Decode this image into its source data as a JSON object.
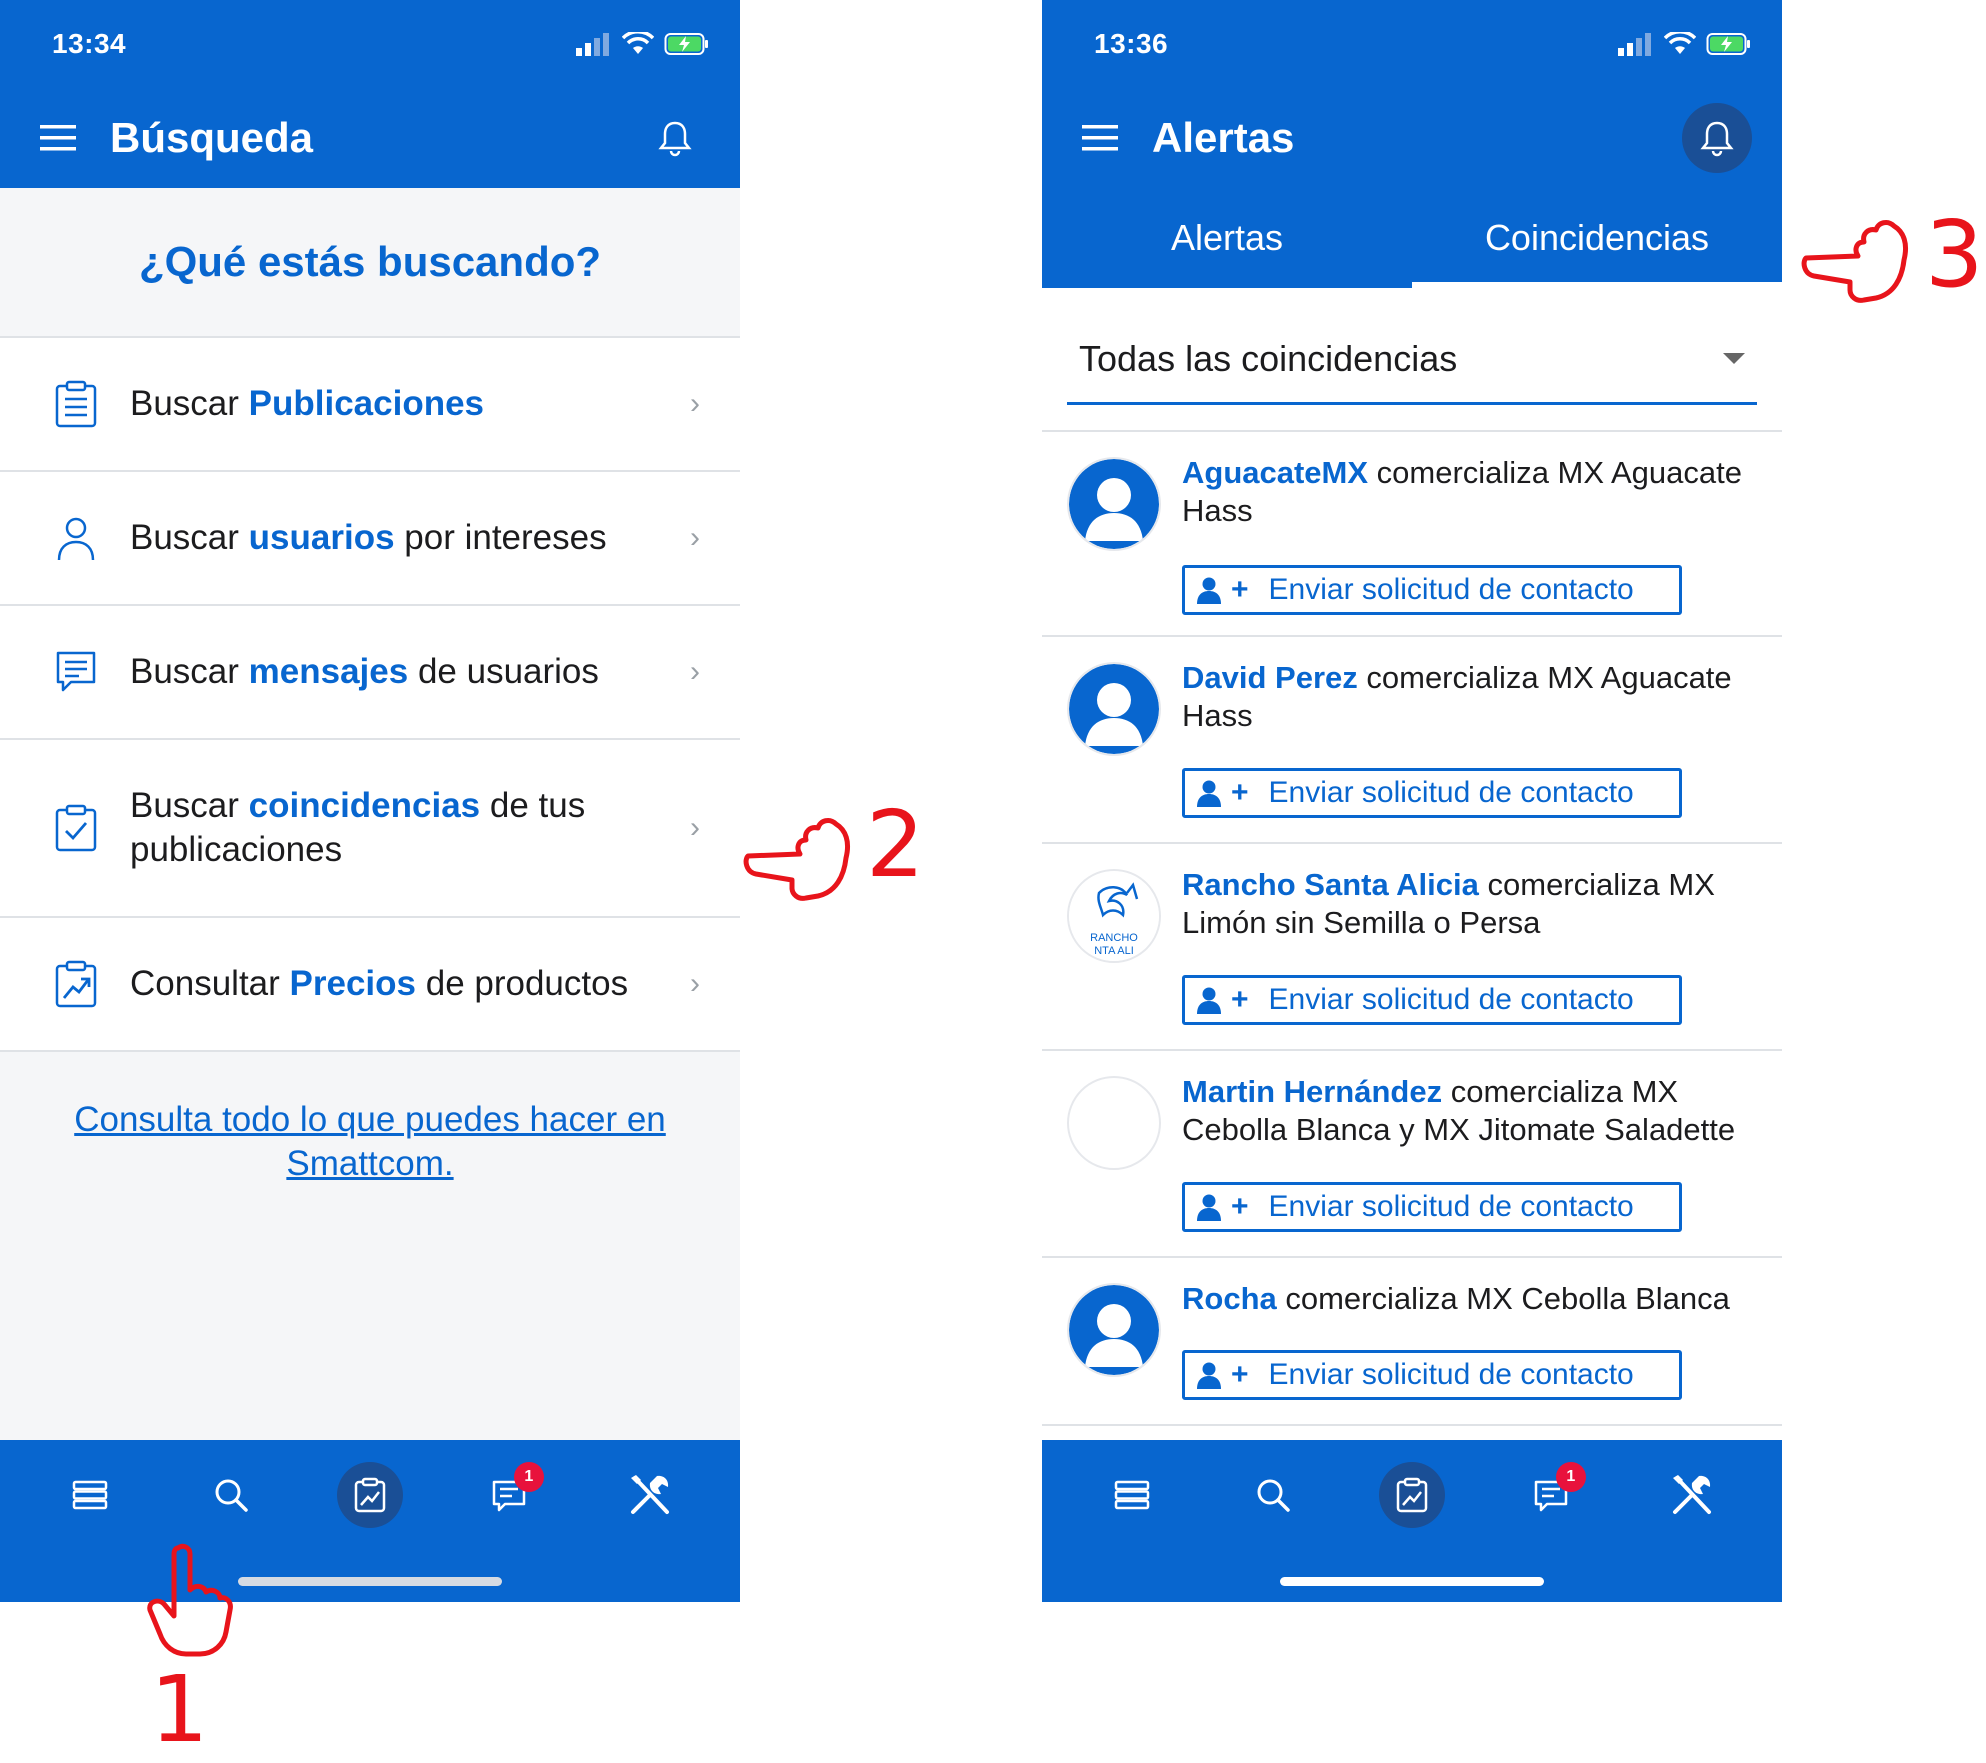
{
  "colors": {
    "brand": "#0866cf",
    "annotation": "#e8141b",
    "badge": "#e8123c"
  },
  "left": {
    "status_time": "13:34",
    "title": "Búsqueda",
    "hero": "¿Qué estás buscando?",
    "items": [
      {
        "icon": "clipboard-list-icon",
        "pre": "Buscar ",
        "bold": "Publicaciones",
        "post": ""
      },
      {
        "icon": "user-icon",
        "pre": "Buscar ",
        "bold": "usuarios",
        "post": " por intereses"
      },
      {
        "icon": "message-icon",
        "pre": "Buscar ",
        "bold": "mensajes",
        "post": " de usuarios"
      },
      {
        "icon": "clipboard-check-icon",
        "pre": "Buscar ",
        "bold": "coincidencias",
        "post": " de tus publicaciones"
      },
      {
        "icon": "chart-trend-icon",
        "pre": "Consultar ",
        "bold": "Precios",
        "post": " de productos"
      }
    ],
    "help_link": "Consulta todo lo que puedes hacer en Smattcom.",
    "tabbar_badge": "1"
  },
  "right": {
    "status_time": "13:36",
    "title": "Alertas",
    "tabs": [
      "Alertas",
      "Coincidencias"
    ],
    "filter": "Todas las coincidencias",
    "matches": [
      {
        "name": "AguacateMX",
        "rest": " comercializa MX Aguacate Hass",
        "avatar": "default"
      },
      {
        "name": "David Perez",
        "rest": " comercializa MX Aguacate Hass",
        "avatar": "default"
      },
      {
        "name": "Rancho Santa Alicia",
        "rest": " comercializa MX Limón sin Semilla o Persa",
        "avatar": "logo",
        "logo_text": "RANCHO\nNTA ALI"
      },
      {
        "name": "Martin Hernández",
        "rest": " comercializa MX Cebolla Blanca y MX Jitomate Saladette",
        "avatar": "empty"
      },
      {
        "name": "Rocha",
        "rest": " comercializa MX Cebolla Blanca",
        "avatar": "default"
      }
    ],
    "contact_button": "Enviar solicitud de contacto",
    "tabbar_badge": "1"
  },
  "annotations": [
    "1",
    "2",
    "3"
  ]
}
